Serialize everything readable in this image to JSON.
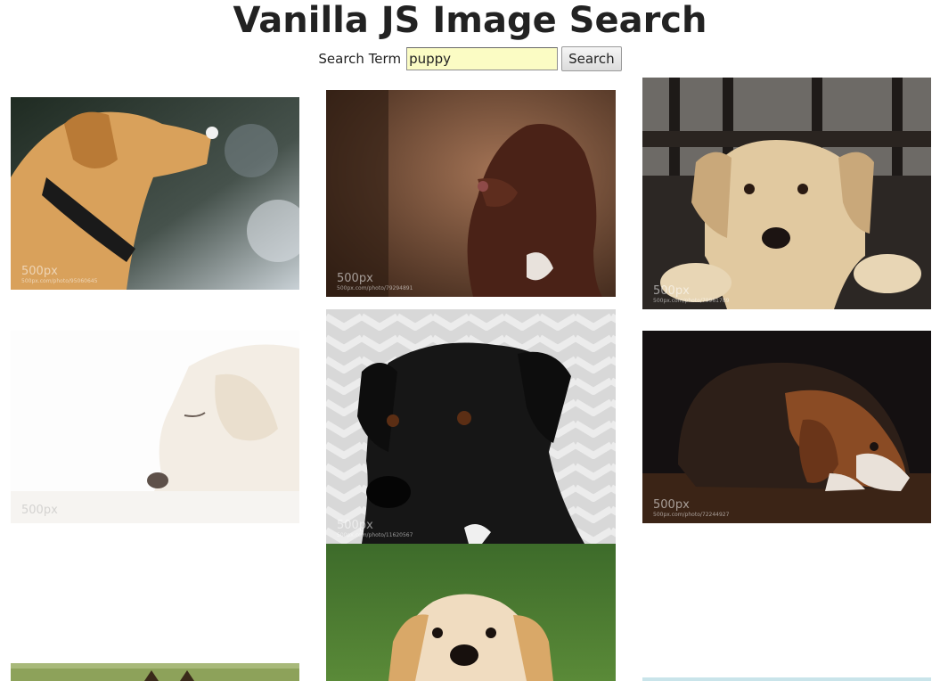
{
  "page": {
    "title": "Vanilla JS Image Search"
  },
  "search": {
    "label": "Search Term",
    "value": "puppy",
    "button_label": "Search"
  },
  "results": [
    {
      "alt": "golden dog with snow on nose",
      "watermark": "500px",
      "url": "500px.com/photo/95060645"
    },
    {
      "alt": "brown curly puppy",
      "watermark": "500px",
      "url": "500px.com/photo/79294891"
    },
    {
      "alt": "puppy under gate",
      "watermark": "500px",
      "url": "500px.com/photo/79961789"
    },
    {
      "alt": "white puppy on white background",
      "watermark": "500px",
      "url": ""
    },
    {
      "alt": "black dog on chevron background",
      "watermark": "500px",
      "url": "500px.com/photo/11620567"
    },
    {
      "alt": "beagle lying on wood floor",
      "watermark": "500px",
      "url": "500px.com/photo/72244927"
    },
    {
      "alt": "dog on grass (partially visible)",
      "watermark": "",
      "url": ""
    },
    {
      "alt": "golden puppy on grass",
      "watermark": "",
      "url": ""
    },
    {
      "alt": "image partially visible",
      "watermark": "",
      "url": ""
    }
  ]
}
